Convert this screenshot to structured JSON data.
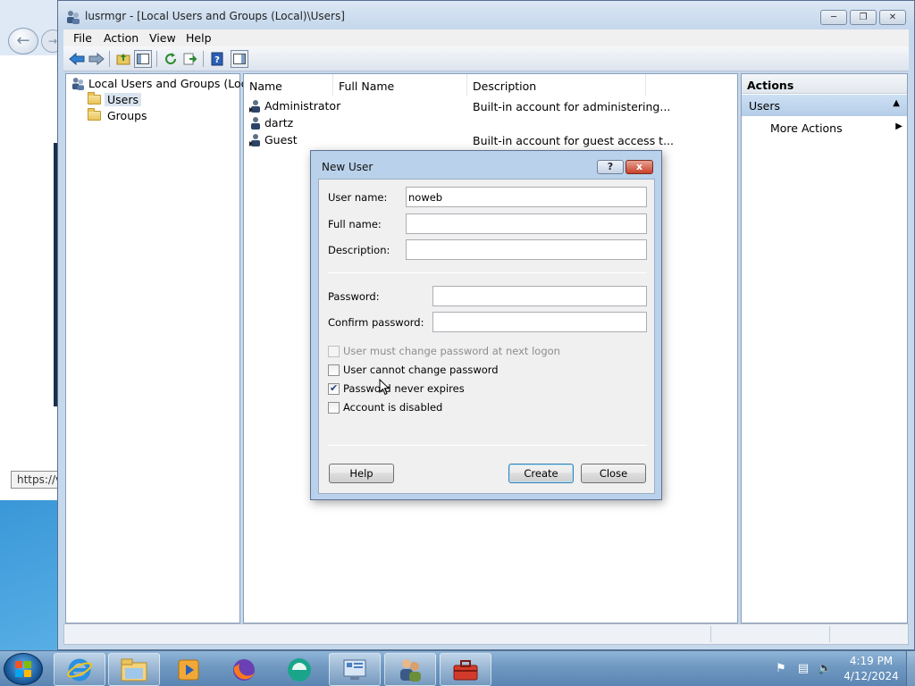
{
  "browser": {
    "status_text": "https://v"
  },
  "window": {
    "title": "lusrmgr - [Local Users and Groups (Local)\\Users]",
    "menu": [
      "File",
      "Action",
      "View",
      "Help"
    ]
  },
  "tree": {
    "root": "Local Users and Groups (Local)",
    "items": [
      "Users",
      "Groups"
    ]
  },
  "list": {
    "columns": [
      "Name",
      "Full Name",
      "Description"
    ],
    "rows": [
      {
        "name": "Administrator",
        "full_name": "",
        "description": "Built-in account for administering..."
      },
      {
        "name": "dartz",
        "full_name": "",
        "description": ""
      },
      {
        "name": "Guest",
        "full_name": "",
        "description": "Built-in account for guest access t..."
      }
    ]
  },
  "actions": {
    "header": "Actions",
    "section": "Users",
    "items": [
      "More Actions"
    ]
  },
  "dialog": {
    "title": "New User",
    "help_symbol": "?",
    "close_symbol": "x",
    "fields": {
      "username_label": "User name:",
      "username_value": "noweb",
      "fullname_label": "Full name:",
      "fullname_value": "",
      "description_label": "Description:",
      "description_value": "",
      "password_label": "Password:",
      "password_value": "",
      "confirm_label": "Confirm password:",
      "confirm_value": ""
    },
    "checkboxes": [
      {
        "label": "User must change password at next logon",
        "checked": false,
        "disabled": true
      },
      {
        "label": "User cannot change password",
        "checked": false,
        "disabled": false
      },
      {
        "label": "Password never expires",
        "checked": true,
        "disabled": false
      },
      {
        "label": "Account is disabled",
        "checked": false,
        "disabled": false
      }
    ],
    "buttons": {
      "help": "Help",
      "create": "Create",
      "close": "Close"
    }
  },
  "taskbar": {
    "pinned": [
      "internet-explorer-icon",
      "file-explorer-icon",
      "media-player-icon",
      "firefox-icon",
      "app-icon",
      "server-manager-icon",
      "users-icon",
      "toolbox-icon"
    ],
    "time": "4:19 PM",
    "date": "4/12/2024"
  },
  "colors": {
    "dialog_frame": "#b9d1ea",
    "window_frame": "#c6d8ec",
    "close_button": "#c8402b",
    "selection": "#cde0f3"
  }
}
